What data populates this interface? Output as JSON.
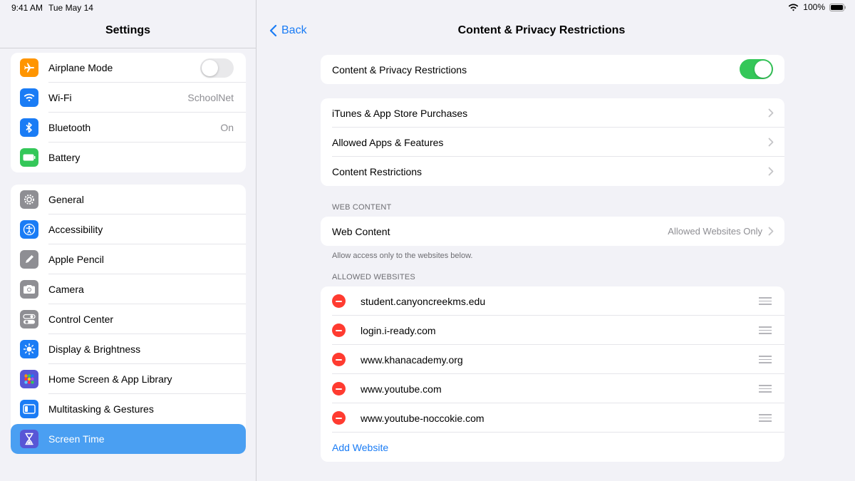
{
  "status": {
    "time": "9:41 AM",
    "date": "Tue May 14",
    "battery": "100%"
  },
  "sidebar": {
    "title": "Settings",
    "group1": [
      {
        "label": "Airplane Mode",
        "icon": "airplane-icon",
        "color": "#ff9500",
        "toggle": false
      },
      {
        "label": "Wi-Fi",
        "icon": "wifi-icon",
        "color": "#1a7cf5",
        "value": "SchoolNet"
      },
      {
        "label": "Bluetooth",
        "icon": "bluetooth-icon",
        "color": "#1a7cf5",
        "value": "On"
      },
      {
        "label": "Battery",
        "icon": "battery-icon",
        "color": "#34c759"
      }
    ],
    "group2": [
      {
        "label": "General",
        "icon": "gear-icon",
        "color": "#8e8e93"
      },
      {
        "label": "Accessibility",
        "icon": "accessibility-icon",
        "color": "#1a7cf5"
      },
      {
        "label": "Apple Pencil",
        "icon": "pencil-icon",
        "color": "#8e8e93"
      },
      {
        "label": "Camera",
        "icon": "camera-icon",
        "color": "#8e8e93"
      },
      {
        "label": "Control Center",
        "icon": "control-center-icon",
        "color": "#8e8e93"
      },
      {
        "label": "Display & Brightness",
        "icon": "brightness-icon",
        "color": "#1a7cf5"
      },
      {
        "label": "Home Screen & App Library",
        "icon": "home-screen-icon",
        "color": "#5856d6"
      },
      {
        "label": "Multitasking & Gestures",
        "icon": "multitasking-icon",
        "color": "#1a7cf5"
      },
      {
        "label": "Screen Time",
        "icon": "hourglass-icon",
        "color": "#5856d6",
        "selected": true
      }
    ]
  },
  "detail": {
    "back_label": "Back",
    "title": "Content & Privacy Restrictions",
    "main_toggle_label": "Content & Privacy Restrictions",
    "main_toggle_on": true,
    "nav_rows": [
      {
        "label": "iTunes & App Store Purchases"
      },
      {
        "label": "Allowed Apps & Features"
      },
      {
        "label": "Content Restrictions"
      }
    ],
    "web_content_header": "WEB CONTENT",
    "web_content": {
      "label": "Web Content",
      "value": "Allowed Websites Only"
    },
    "web_content_footer": "Allow access only to the websites below.",
    "allowed_header": "ALLOWED WEBSITES",
    "websites": [
      "student.canyoncreekms.edu",
      "login.i-ready.com",
      "www.khanacademy.org",
      "www.youtube.com",
      "www.youtube-noccokie.com"
    ],
    "add_website": "Add Website"
  },
  "colors": {
    "accent": "#1a7cf5",
    "selected_row": "#4a9ff2",
    "toggle_on": "#34c759",
    "delete": "#ff3b30"
  }
}
